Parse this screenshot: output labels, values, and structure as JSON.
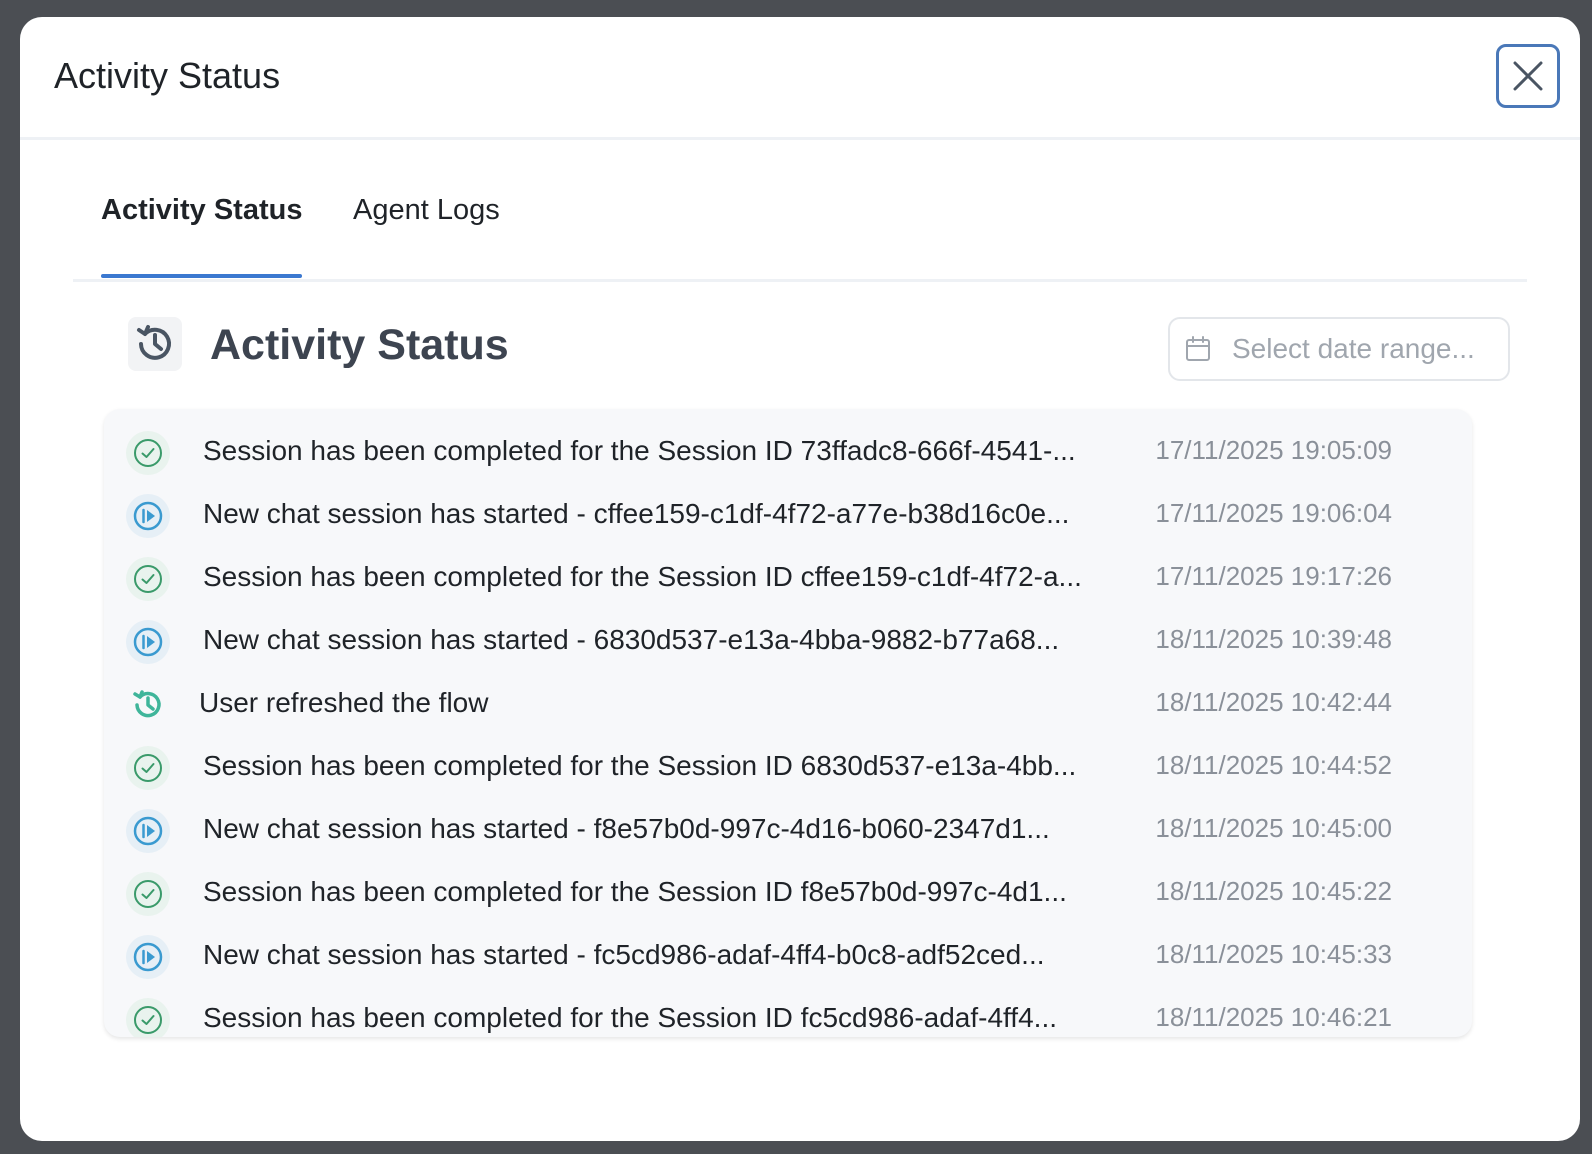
{
  "modal": {
    "title": "Activity Status"
  },
  "tabs": [
    {
      "label": "Activity Status",
      "active": true
    },
    {
      "label": "Agent Logs",
      "active": false
    }
  ],
  "section": {
    "title": "Activity Status",
    "icon": "history-icon"
  },
  "date_range": {
    "placeholder": "Select date range...",
    "icon": "calendar-icon"
  },
  "colors": {
    "accent": "#3b78d0",
    "complete": "#3a9a6a",
    "start": "#3a9ad0",
    "refresh": "#3fb59a"
  },
  "logs": [
    {
      "type": "complete",
      "icon": "check-circle-icon",
      "message": "Session has been completed for the Session ID 73ffadc8-666f-4541-...",
      "time": "17/11/2025 19:05:09"
    },
    {
      "type": "start",
      "icon": "play-circle-icon",
      "message": "New chat session has started - cffee159-c1df-4f72-a77e-b38d16c0e...",
      "time": "17/11/2025 19:06:04"
    },
    {
      "type": "complete",
      "icon": "check-circle-icon",
      "message": "Session has been completed for the Session ID cffee159-c1df-4f72-a...",
      "time": "17/11/2025 19:17:26"
    },
    {
      "type": "start",
      "icon": "play-circle-icon",
      "message": "New chat session has started - 6830d537-e13a-4bba-9882-b77a68...",
      "time": "18/11/2025 10:39:48"
    },
    {
      "type": "refresh",
      "icon": "history-icon",
      "message": "User refreshed the flow",
      "time": "18/11/2025 10:42:44"
    },
    {
      "type": "complete",
      "icon": "check-circle-icon",
      "message": "Session has been completed for the Session ID 6830d537-e13a-4bb...",
      "time": "18/11/2025 10:44:52"
    },
    {
      "type": "start",
      "icon": "play-circle-icon",
      "message": "New chat session has started - f8e57b0d-997c-4d16-b060-2347d1...",
      "time": "18/11/2025 10:45:00"
    },
    {
      "type": "complete",
      "icon": "check-circle-icon",
      "message": "Session has been completed for the Session ID f8e57b0d-997c-4d1...",
      "time": "18/11/2025 10:45:22"
    },
    {
      "type": "start",
      "icon": "play-circle-icon",
      "message": "New chat session has started - fc5cd986-adaf-4ff4-b0c8-adf52ced...",
      "time": "18/11/2025 10:45:33"
    },
    {
      "type": "complete",
      "icon": "check-circle-icon",
      "message": "Session has been completed for the Session ID fc5cd986-adaf-4ff4...",
      "time": "18/11/2025 10:46:21"
    }
  ]
}
